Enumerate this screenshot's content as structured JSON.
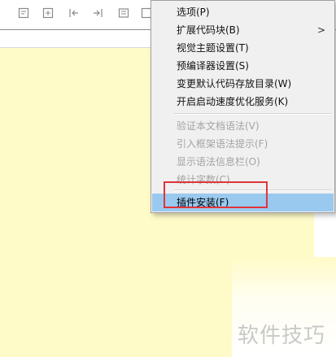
{
  "toolbar": {
    "icons": [
      "page-icon",
      "export-icon",
      "indent-left-icon",
      "indent-right-icon",
      "list-icon",
      "page-icon"
    ]
  },
  "menu": {
    "items": [
      {
        "label": "选项(P)",
        "enabled": true
      },
      {
        "label": "扩展代码块(B)",
        "enabled": true,
        "submenu": true,
        "arrow": ">"
      },
      {
        "label": "视觉主题设置(T)",
        "enabled": true
      },
      {
        "label": "预编译器设置(S)",
        "enabled": true
      },
      {
        "label": "变更默认代码存放目录(W)",
        "enabled": true
      },
      {
        "label": "开启启动速度优化服务(K)",
        "enabled": true
      },
      {
        "label": "验证本文档语法(V)",
        "enabled": false
      },
      {
        "label": "引入框架语法提示(F)",
        "enabled": false
      },
      {
        "label": "显示语法信息栏(O)",
        "enabled": false
      },
      {
        "label": "统计字数(C)",
        "enabled": false
      },
      {
        "label": "插件安装(F)",
        "enabled": true,
        "selected": true
      }
    ]
  },
  "colors": {
    "editor_background": "#fffbc9",
    "selection": "#99c9ef",
    "annotation_box": "#e0353b"
  },
  "watermark": "软件技巧"
}
